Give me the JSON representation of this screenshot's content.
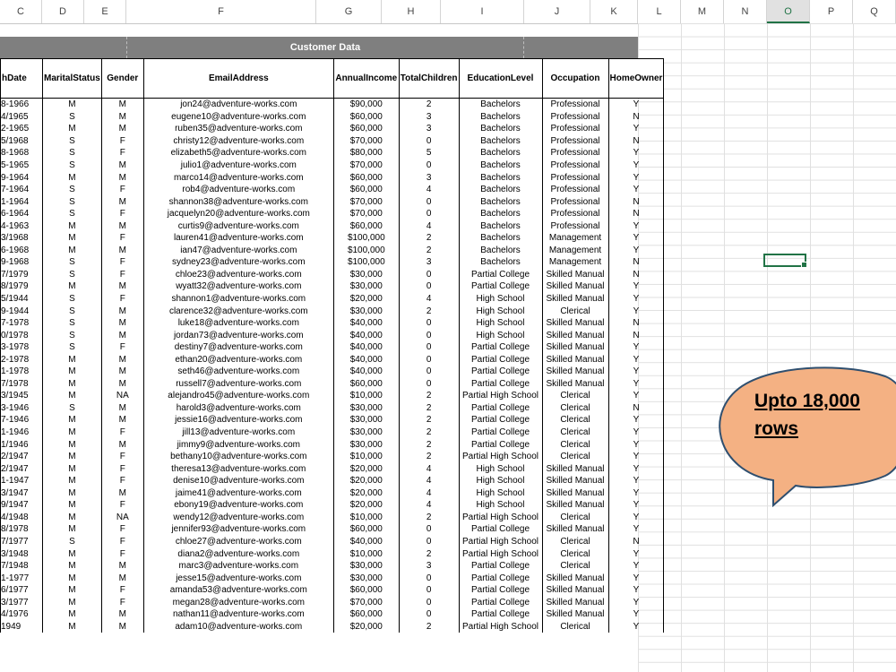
{
  "column_headers": [
    "C",
    "D",
    "E",
    "F",
    "G",
    "H",
    "I",
    "J",
    "K",
    "L",
    "M",
    "N",
    "O",
    "P",
    "Q"
  ],
  "selected_column": "O",
  "banner_title": "Customer Data",
  "table_headers": [
    "hDate",
    "MaritalStatus",
    "Gender",
    "EmailAddress",
    "AnnualIncome",
    "TotalChildren",
    "EducationLevel",
    "Occupation",
    "HomeOwner"
  ],
  "rows": [
    [
      "8-1966",
      "M",
      "M",
      "jon24@adventure-works.com",
      "$90,000",
      "2",
      "Bachelors",
      "Professional",
      "Y"
    ],
    [
      "4/1965",
      "S",
      "M",
      "eugene10@adventure-works.com",
      "$60,000",
      "3",
      "Bachelors",
      "Professional",
      "N"
    ],
    [
      "2-1965",
      "M",
      "M",
      "ruben35@adventure-works.com",
      "$60,000",
      "3",
      "Bachelors",
      "Professional",
      "Y"
    ],
    [
      "5/1968",
      "S",
      "F",
      "christy12@adventure-works.com",
      "$70,000",
      "0",
      "Bachelors",
      "Professional",
      "N"
    ],
    [
      "8-1968",
      "S",
      "F",
      "elizabeth5@adventure-works.com",
      "$80,000",
      "5",
      "Bachelors",
      "Professional",
      "Y"
    ],
    [
      "5-1965",
      "S",
      "M",
      "julio1@adventure-works.com",
      "$70,000",
      "0",
      "Bachelors",
      "Professional",
      "Y"
    ],
    [
      "9-1964",
      "M",
      "M",
      "marco14@adventure-works.com",
      "$60,000",
      "3",
      "Bachelors",
      "Professional",
      "Y"
    ],
    [
      "7-1964",
      "S",
      "F",
      "rob4@adventure-works.com",
      "$60,000",
      "4",
      "Bachelors",
      "Professional",
      "Y"
    ],
    [
      "1-1964",
      "S",
      "M",
      "shannon38@adventure-works.com",
      "$70,000",
      "0",
      "Bachelors",
      "Professional",
      "N"
    ],
    [
      "6-1964",
      "S",
      "F",
      "jacquelyn20@adventure-works.com",
      "$70,000",
      "0",
      "Bachelors",
      "Professional",
      "N"
    ],
    [
      "4-1963",
      "M",
      "M",
      "curtis9@adventure-works.com",
      "$60,000",
      "4",
      "Bachelors",
      "Professional",
      "Y"
    ],
    [
      "3/1968",
      "M",
      "F",
      "lauren41@adventure-works.com",
      "$100,000",
      "2",
      "Bachelors",
      "Management",
      "Y"
    ],
    [
      "6-1968",
      "M",
      "M",
      "ian47@adventure-works.com",
      "$100,000",
      "2",
      "Bachelors",
      "Management",
      "Y"
    ],
    [
      "9-1968",
      "S",
      "F",
      "sydney23@adventure-works.com",
      "$100,000",
      "3",
      "Bachelors",
      "Management",
      "N"
    ],
    [
      "7/1979",
      "S",
      "F",
      "chloe23@adventure-works.com",
      "$30,000",
      "0",
      "Partial College",
      "Skilled Manual",
      "N"
    ],
    [
      "8/1979",
      "M",
      "M",
      "wyatt32@adventure-works.com",
      "$30,000",
      "0",
      "Partial College",
      "Skilled Manual",
      "Y"
    ],
    [
      "5/1944",
      "S",
      "F",
      "shannon1@adventure-works.com",
      "$20,000",
      "4",
      "High School",
      "Skilled Manual",
      "Y"
    ],
    [
      "9-1944",
      "S",
      "M",
      "clarence32@adventure-works.com",
      "$30,000",
      "2",
      "High School",
      "Clerical",
      "Y"
    ],
    [
      "7-1978",
      "S",
      "M",
      "luke18@adventure-works.com",
      "$40,000",
      "0",
      "High School",
      "Skilled Manual",
      "N"
    ],
    [
      "0/1978",
      "S",
      "M",
      "jordan73@adventure-works.com",
      "$40,000",
      "0",
      "High School",
      "Skilled Manual",
      "N"
    ],
    [
      "3-1978",
      "S",
      "F",
      "destiny7@adventure-works.com",
      "$40,000",
      "0",
      "Partial College",
      "Skilled Manual",
      "Y"
    ],
    [
      "2-1978",
      "M",
      "M",
      "ethan20@adventure-works.com",
      "$40,000",
      "0",
      "Partial College",
      "Skilled Manual",
      "Y"
    ],
    [
      "1-1978",
      "M",
      "M",
      "seth46@adventure-works.com",
      "$40,000",
      "0",
      "Partial College",
      "Skilled Manual",
      "Y"
    ],
    [
      "7/1978",
      "M",
      "M",
      "russell7@adventure-works.com",
      "$60,000",
      "0",
      "Partial College",
      "Skilled Manual",
      "Y"
    ],
    [
      "3/1945",
      "M",
      "NA",
      "alejandro45@adventure-works.com",
      "$10,000",
      "2",
      "Partial High School",
      "Clerical",
      "Y"
    ],
    [
      "3-1946",
      "S",
      "M",
      "harold3@adventure-works.com",
      "$30,000",
      "2",
      "Partial College",
      "Clerical",
      "N"
    ],
    [
      "7-1946",
      "M",
      "M",
      "jessie16@adventure-works.com",
      "$30,000",
      "2",
      "Partial College",
      "Clerical",
      "Y"
    ],
    [
      "1-1946",
      "M",
      "F",
      "jill13@adventure-works.com",
      "$30,000",
      "2",
      "Partial College",
      "Clerical",
      "Y"
    ],
    [
      "1/1946",
      "M",
      "M",
      "jimmy9@adventure-works.com",
      "$30,000",
      "2",
      "Partial College",
      "Clerical",
      "Y"
    ],
    [
      "2/1947",
      "M",
      "F",
      "bethany10@adventure-works.com",
      "$10,000",
      "2",
      "Partial High School",
      "Clerical",
      "Y"
    ],
    [
      "2/1947",
      "M",
      "F",
      "theresa13@adventure-works.com",
      "$20,000",
      "4",
      "High School",
      "Skilled Manual",
      "Y"
    ],
    [
      "1-1947",
      "M",
      "F",
      "denise10@adventure-works.com",
      "$20,000",
      "4",
      "High School",
      "Skilled Manual",
      "Y"
    ],
    [
      "3/1947",
      "M",
      "M",
      "jaime41@adventure-works.com",
      "$20,000",
      "4",
      "High School",
      "Skilled Manual",
      "Y"
    ],
    [
      "9/1947",
      "M",
      "F",
      "ebony19@adventure-works.com",
      "$20,000",
      "4",
      "High School",
      "Skilled Manual",
      "Y"
    ],
    [
      "4/1948",
      "M",
      "NA",
      "wendy12@adventure-works.com",
      "$10,000",
      "2",
      "Partial High School",
      "Clerical",
      "Y"
    ],
    [
      "8/1978",
      "M",
      "F",
      "jennifer93@adventure-works.com",
      "$60,000",
      "0",
      "Partial College",
      "Skilled Manual",
      "Y"
    ],
    [
      "7/1977",
      "S",
      "F",
      "chloe27@adventure-works.com",
      "$40,000",
      "0",
      "Partial High School",
      "Clerical",
      "N"
    ],
    [
      "3/1948",
      "M",
      "F",
      "diana2@adventure-works.com",
      "$10,000",
      "2",
      "Partial High School",
      "Clerical",
      "Y"
    ],
    [
      "7/1948",
      "M",
      "M",
      "marc3@adventure-works.com",
      "$30,000",
      "3",
      "Partial College",
      "Clerical",
      "Y"
    ],
    [
      "1-1977",
      "M",
      "M",
      "jesse15@adventure-works.com",
      "$30,000",
      "0",
      "Partial College",
      "Skilled Manual",
      "Y"
    ],
    [
      "6/1977",
      "M",
      "F",
      "amanda53@adventure-works.com",
      "$60,000",
      "0",
      "Partial College",
      "Skilled Manual",
      "Y"
    ],
    [
      "3/1977",
      "M",
      "F",
      "megan28@adventure-works.com",
      "$70,000",
      "0",
      "Partial College",
      "Skilled Manual",
      "Y"
    ],
    [
      "4/1976",
      "M",
      "M",
      "nathan11@adventure-works.com",
      "$60,000",
      "0",
      "Partial College",
      "Skilled Manual",
      "Y"
    ],
    [
      "1949",
      "M",
      "M",
      "adam10@adventure-works.com",
      "$20,000",
      "2",
      "Partial High School",
      "Clerical",
      "Y"
    ]
  ],
  "callout": {
    "line1": "Upto 18,000",
    "line2": "rows",
    "fill": "#f4b183",
    "stroke": "#2f4f6f"
  },
  "colors": {
    "banner": "#7f7f7f",
    "selection": "#217346"
  }
}
